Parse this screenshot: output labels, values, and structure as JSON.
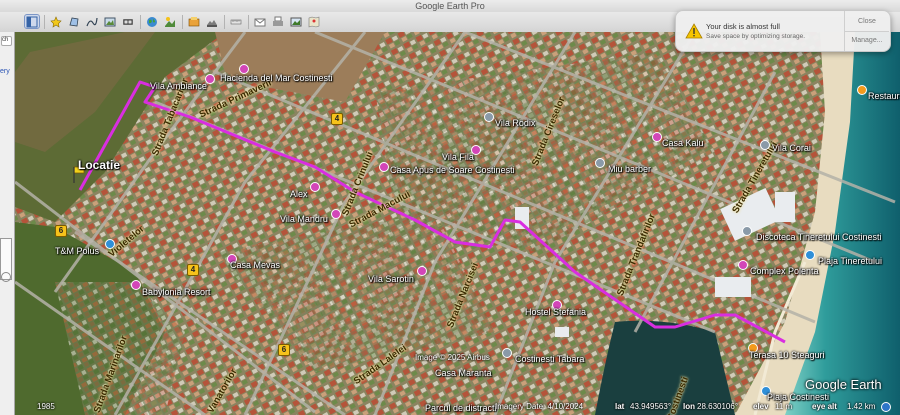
{
  "window": {
    "title": "Google Earth Pro"
  },
  "toolbar": {
    "buttons": [
      "sidebar",
      "placemark",
      "polygon",
      "path",
      "overlay",
      "tour",
      "earth",
      "sun",
      "historical",
      "planets",
      "ruler",
      "email",
      "print",
      "save-image",
      "maps"
    ]
  },
  "leftpanel": {
    "search_fragment": "ch",
    "tab_fragment": "ery"
  },
  "notification": {
    "title": "Your disk is almost full",
    "body": "Save space by optimizing storage.",
    "close_label": "Close",
    "manage_label": "Manage..."
  },
  "map": {
    "location_label": "Locatie",
    "places": {
      "vila_ambiance": "Vila Ambiance",
      "hacienda": "Hacienda del Mar Costinesti",
      "vila_rodix": "Vila Rodix",
      "casa_kalu": "Casa Kalu",
      "vila_corai": "Vila Corai",
      "vila_fila": "Vila Fila",
      "casa_apus": "Casa Apus de Soare Costinesti",
      "miu_barber": "Miu barber",
      "alex": "Alex",
      "vila_mandru": "Vila Mandru",
      "tm_polus": "T&M Polus",
      "casa_mevas": "Casa Mevas",
      "vila_sarotin": "Vila Sarotin",
      "babylonia": "Babylonia Resort",
      "hostel_stefania": "Hostel Stefania",
      "complex_polenta": "Complex Polenta",
      "discoteca": "Discoteca Tineretului Costinesti",
      "plaja_tineretului": "Plaja Tineretului",
      "costinesti_tabara": "Costinesti Tabara",
      "casa_maranta": "Casa Maranta",
      "terasa": "Terasa 10 Steaguri",
      "plaja_costinesti": "Plaja Costinesti",
      "restaurant": "Restaura",
      "parc": "Parcul de distracti"
    },
    "streets": {
      "tabacarilor": "Strada Tabacarilor",
      "primaverii": "Strada Primaverii",
      "macului": "Strada Macului",
      "violetelor": "Violetelor",
      "crinului": "Strada Crinului",
      "narcisei": "Strada Narcisei",
      "lalelei": "Strada Lalelei",
      "trandafirilor": "Strada Trandafirilor",
      "cireselor": "Strada Cireselor",
      "marinarilor": "Strada Marinarilor",
      "tineretului": "Strada Tineretului",
      "costinesti": "Costinesti",
      "vanatorilor": "Vanatorilor"
    },
    "shields": [
      "4",
      "6",
      "4",
      "6"
    ],
    "brand": "Google Earth"
  },
  "statusbar": {
    "year": "1985",
    "copyright": "Image © 2025 Airbus",
    "imagery_date": "Imagery Date: 4/10/2024",
    "lat_label": "lat",
    "lat": "43.949563°",
    "lon_label": "lon",
    "lon": "28.630106°",
    "elev_label": "elev",
    "elev": "11 m",
    "eye_label": "eye alt",
    "eye": "1.42 km"
  },
  "colors": {
    "route": "#d92ee0",
    "poi": "#d346b8",
    "sea": "#2f9c9b",
    "road": "#b4b2a8"
  }
}
